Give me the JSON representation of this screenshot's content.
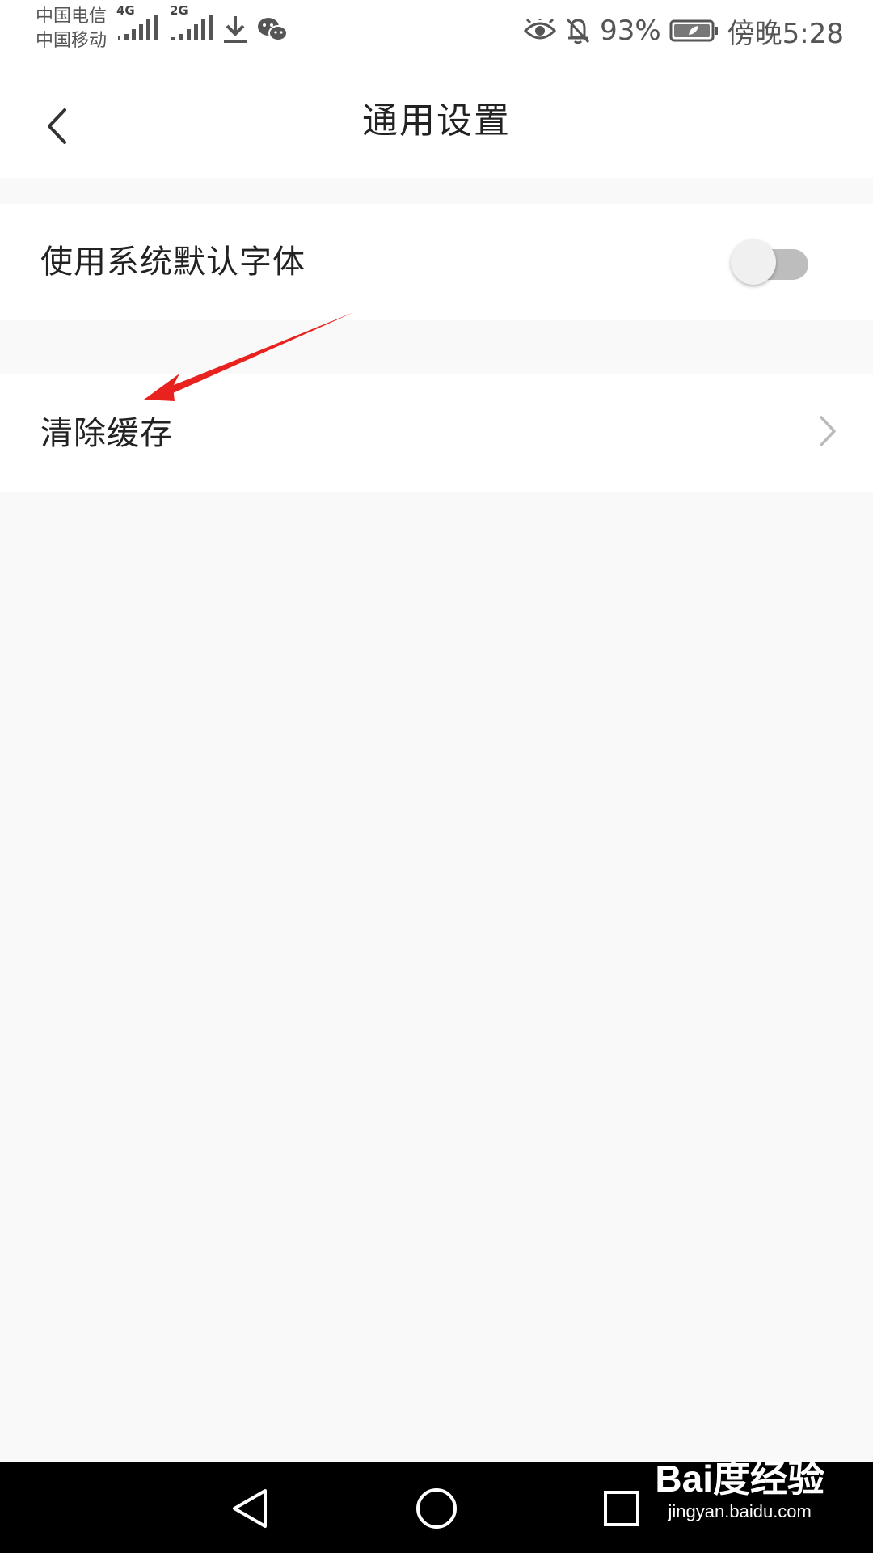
{
  "status_bar": {
    "carrier_1": "中国电信",
    "carrier_2": "中国移动",
    "network_1": "4G",
    "network_2": "2G",
    "battery": "93%",
    "time": "傍晚5:28",
    "icons": [
      "signal-icon",
      "download-icon",
      "wechat-icon",
      "eye-icon",
      "bell-off-icon",
      "battery-icon"
    ]
  },
  "header": {
    "title": "通用设置",
    "back_icon": "chevron-left-icon"
  },
  "settings": {
    "system_font": {
      "label": "使用系统默认字体",
      "enabled": false
    },
    "clear_cache": {
      "label": "清除缓存",
      "chevron_icon": "chevron-right-icon"
    }
  },
  "annotation": {
    "color": "#e8231f",
    "icon": "red-arrow-icon"
  },
  "nav_bar": {
    "icons": [
      "back-triangle-icon",
      "home-circle-icon",
      "recents-square-icon"
    ]
  },
  "watermark": {
    "brand": "Bai度经验",
    "url": "jingyan.baidu.com"
  },
  "colors": {
    "background": "#f9f9f9",
    "row": "#ffffff",
    "toggle_off": "#bdbdbd",
    "text": "#222222"
  }
}
